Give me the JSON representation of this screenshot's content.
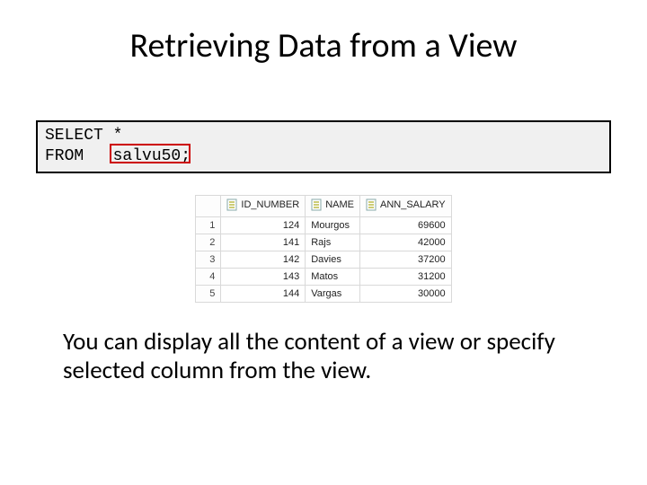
{
  "title": "Retrieving Data from a View",
  "code": {
    "line1": "SELECT *",
    "line2": "FROM   salvu50;"
  },
  "table": {
    "headers": [
      "",
      "ID_NUMBER",
      "NAME",
      "ANN_SALARY"
    ],
    "rows": [
      {
        "n": "1",
        "id": "124",
        "name": "Mourgos",
        "sal": "69600"
      },
      {
        "n": "2",
        "id": "141",
        "name": "Rajs",
        "sal": "42000"
      },
      {
        "n": "3",
        "id": "142",
        "name": "Davies",
        "sal": "37200"
      },
      {
        "n": "4",
        "id": "143",
        "name": "Matos",
        "sal": "31200"
      },
      {
        "n": "5",
        "id": "144",
        "name": "Vargas",
        "sal": "30000"
      }
    ]
  },
  "body": "You can display all the content of a view or specify selected column from the view."
}
